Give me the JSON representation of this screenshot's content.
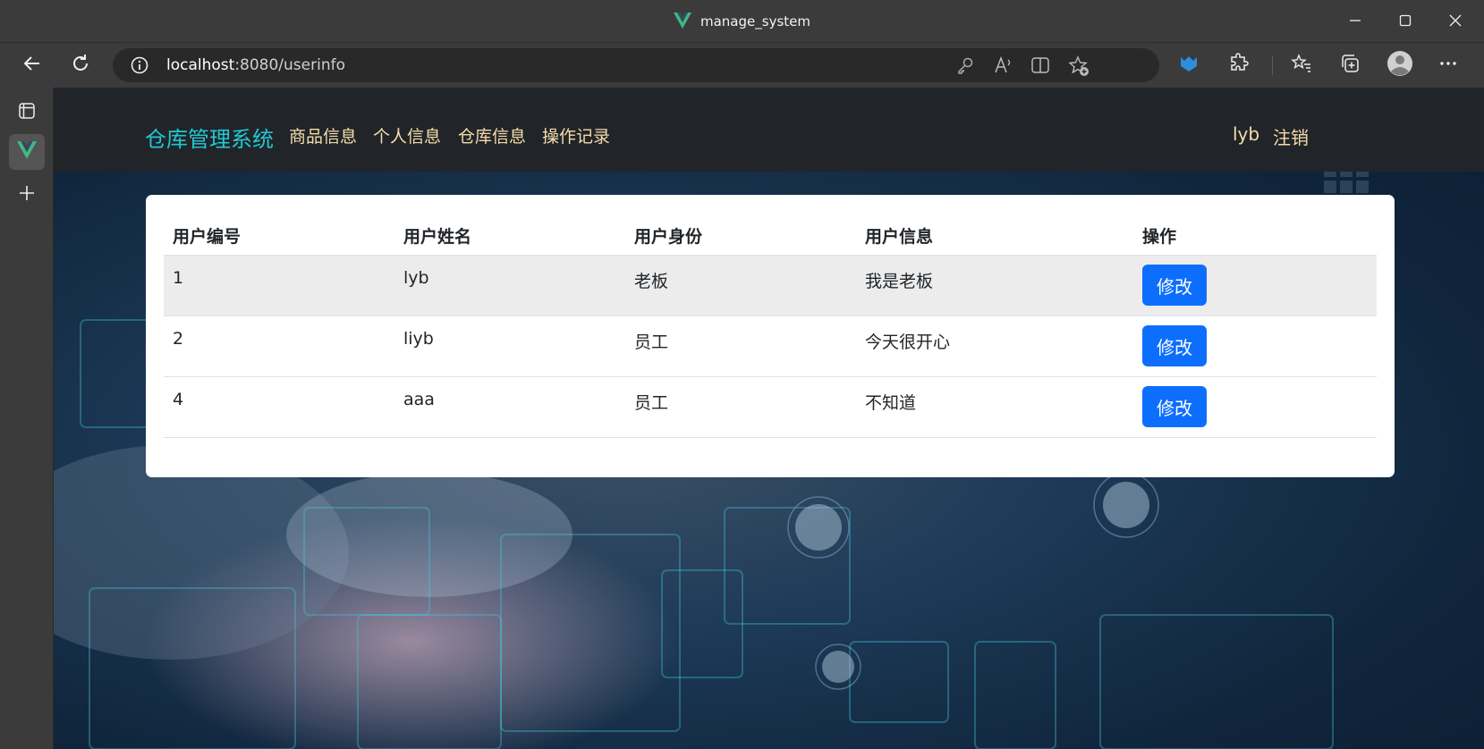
{
  "window": {
    "title": "manage_system"
  },
  "browser": {
    "url_host": "localhost",
    "url_rest": ":8080/userinfo"
  },
  "nav": {
    "brand": "仓库管理系统",
    "links": [
      "商品信息",
      "个人信息",
      "仓库信息",
      "操作记录"
    ],
    "username": "lyb",
    "logout": "注销"
  },
  "table": {
    "headers": [
      "用户编号",
      "用户姓名",
      "用户身份",
      "用户信息",
      "操作"
    ],
    "rows": [
      {
        "id": "1",
        "name": "lyb",
        "role": "老板",
        "info": "我是老板",
        "action": "修改"
      },
      {
        "id": "2",
        "name": "liyb",
        "role": "员工",
        "info": "今天很开心",
        "action": "修改"
      },
      {
        "id": "4",
        "name": "aaa",
        "role": "员工",
        "info": "不知道",
        "action": "修改"
      }
    ]
  },
  "colors": {
    "brand": "#20c9d3",
    "nav_link": "#f6dca9",
    "button": "#0d6efd",
    "navbar": "#212529"
  },
  "icons": [
    "vue-logo-icon",
    "minimize-icon",
    "maximize-icon",
    "close-icon",
    "back-icon",
    "refresh-icon",
    "info-icon",
    "key-icon",
    "read-aloud-icon",
    "split-screen-icon",
    "add-favorite-icon",
    "extension-shield-icon",
    "extensions-icon",
    "favorites-icon",
    "collections-icon",
    "profile-avatar-icon",
    "more-icon",
    "tab-actions-icon",
    "new-tab-icon"
  ]
}
